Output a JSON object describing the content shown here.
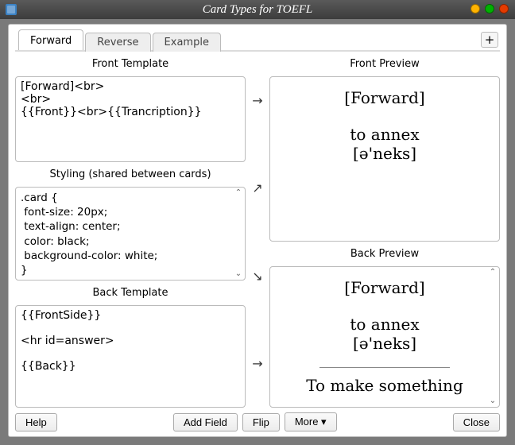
{
  "window": {
    "title": "Card Types for TOEFL"
  },
  "tabs": {
    "t0": "Forward",
    "t1": "Reverse",
    "t2": "Example",
    "add_label": "+"
  },
  "labels": {
    "front_template": "Front Template",
    "styling": "Styling (shared between cards)",
    "back_template": "Back Template",
    "front_preview": "Front Preview",
    "back_preview": "Back Preview"
  },
  "templates": {
    "front": "[Forward]<br>\n<br>\n{{Front}}<br>{{Trancription}}",
    "styling": ".card {\n font-size: 20px;\n text-align: center;\n color: black;\n background-color: white;\n}",
    "back": "{{FrontSide}}\n\n<hr id=answer>\n\n{{Back}}"
  },
  "preview": {
    "front_tag": "[Forward]",
    "front_word": "to annex",
    "front_ipa": "[ə'neks]",
    "back_tag": "[Forward]",
    "back_word": "to annex",
    "back_ipa": "[ə'neks]",
    "back_answer": "To make something"
  },
  "arrows": {
    "right": "→",
    "upright": "↗",
    "downright": "↘"
  },
  "buttons": {
    "help": "Help",
    "add_field": "Add Field",
    "flip": "Flip",
    "more": "More ▾",
    "close": "Close"
  }
}
